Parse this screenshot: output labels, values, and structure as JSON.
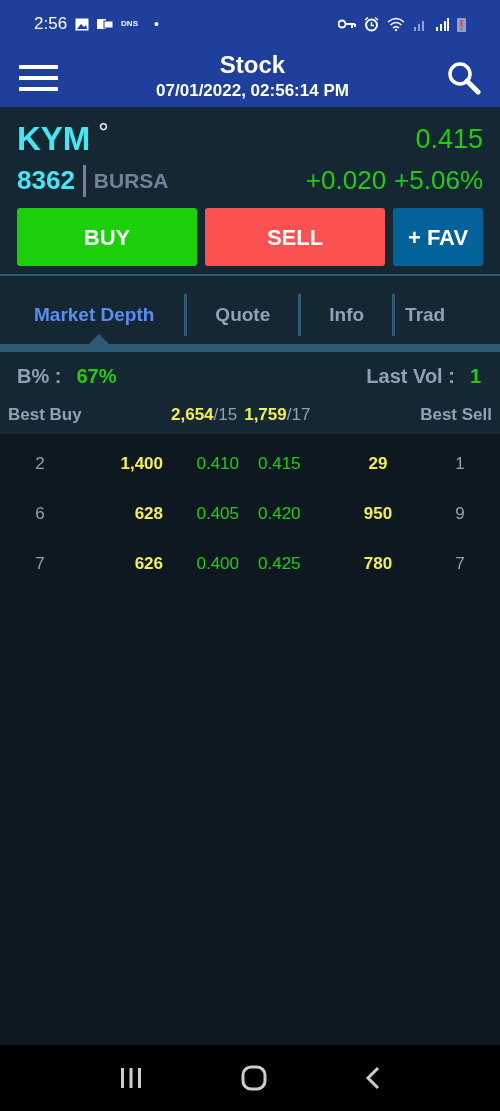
{
  "status_bar": {
    "time": "2:56",
    "dns": "DNS",
    "dot": "•"
  },
  "app_bar": {
    "title": "Stock",
    "datetime": "07/01/2022, 02:56:14 PM"
  },
  "stock": {
    "symbol": "KYM",
    "symbol_mark": "°",
    "code": "8362",
    "exchange": "BURSA",
    "price": "0.415",
    "change": "+0.020",
    "change_percent": "+5.06%"
  },
  "actions": [
    {
      "kind": "buy",
      "label": "BUY"
    },
    {
      "kind": "sell",
      "label": "SELL"
    },
    {
      "kind": "fav",
      "label": "+ FAV"
    }
  ],
  "tabs": [
    {
      "label": "Market Depth",
      "selected": true
    },
    {
      "label": "Quote",
      "selected": false
    },
    {
      "label": "Info",
      "selected": false
    },
    {
      "label": "Trad",
      "selected": false
    }
  ],
  "summary": {
    "b_percent_label": "B% :",
    "b_percent": "67%",
    "last_vol_label": "Last Vol :",
    "last_vol": "1"
  },
  "depth_header": {
    "best_buy": "Best Buy",
    "buy_total_volume": "2,654",
    "buy_total_count": "/15",
    "sell_total_volume": "1,759",
    "sell_total_count": "/17",
    "best_sell": "Best Sell"
  },
  "depth_rows": [
    {
      "buy_count": "2",
      "buy_volume": "1,400",
      "bid": "0.410",
      "ask": "0.415",
      "sell_volume": "29",
      "sell_count": "1"
    },
    {
      "buy_count": "6",
      "buy_volume": "628",
      "bid": "0.405",
      "ask": "0.420",
      "sell_volume": "950",
      "sell_count": "9"
    },
    {
      "buy_count": "7",
      "buy_volume": "626",
      "bid": "0.400",
      "ask": "0.425",
      "sell_volume": "780",
      "sell_count": "7"
    }
  ]
}
